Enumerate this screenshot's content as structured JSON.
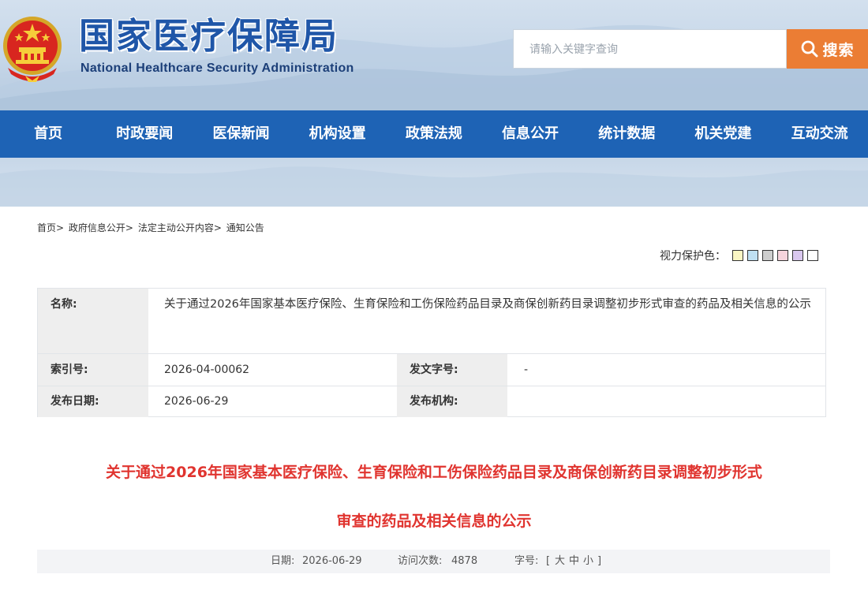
{
  "header": {
    "logo_cn": "国家医疗保障局",
    "logo_en": "National Healthcare Security Administration"
  },
  "search": {
    "placeholder": "请输入关键字查询",
    "button_label": "搜索"
  },
  "nav": {
    "items": [
      "首页",
      "时政要闻",
      "医保新闻",
      "机构设置",
      "政策法规",
      "信息公开",
      "统计数据",
      "机关党建",
      "互动交流"
    ]
  },
  "breadcrumb": {
    "items": [
      "首页",
      "政府信息公开",
      "法定主动公开内容",
      "通知公告"
    ],
    "separator": ">"
  },
  "eye_care": {
    "label": "视力保护色：",
    "colors": [
      "#faf6c4",
      "#bfe0f2",
      "#cdcdcd",
      "#f6d4dc",
      "#d9c7ee",
      "#ffffff"
    ]
  },
  "info_table": {
    "name_label": "名称:",
    "name_value": "关于通过2026年国家基本医疗保险、生育保险和工伤保险药品目录及商保创新药目录调整初步形式审查的药品及相关信息的公示",
    "index_label": "索引号:",
    "index_value": "2026-04-00062",
    "doc_no_label": "发文字号:",
    "doc_no_value": "-",
    "date_label": "发布日期:",
    "date_value": "2026-06-29",
    "org_label": "发布机构:",
    "org_value": ""
  },
  "article": {
    "title_line1": "关于通过2026年国家基本医疗保险、生育保险和工伤保险药品目录及商保创新药目录调整初步形式",
    "title_line2": "审查的药品及相关信息的公示"
  },
  "meta": {
    "date_label": "日期:",
    "date_value": "2026-06-29",
    "visits_label": "访问次数:",
    "visits_value": "4878",
    "font_size_label": "字号:",
    "bracket_open": "[",
    "size_large": "大",
    "size_medium": "中",
    "size_small": "小",
    "bracket_close": "]"
  },
  "colors": {
    "brand_blue": "#1e63b5",
    "search_orange": "#eb7d34",
    "title_red": "#e0342f"
  }
}
